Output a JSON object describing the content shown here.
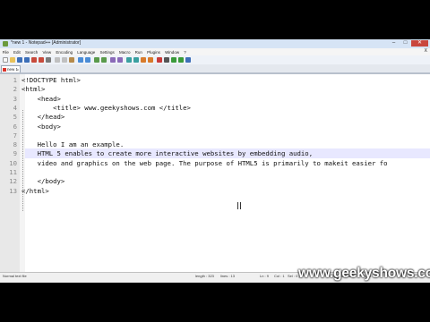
{
  "window": {
    "title": "*new 1 - Notepad++ [Administrator]",
    "minimize_glyph": "–",
    "maximize_glyph": "□",
    "close_glyph": "✕"
  },
  "menu": [
    "File",
    "Edit",
    "Search",
    "View",
    "Encoding",
    "Language",
    "Settings",
    "Macro",
    "Run",
    "Plugins",
    "Window",
    "?"
  ],
  "menu_close_glyph": "X",
  "tab": {
    "label": "new 1",
    "close_glyph": "x"
  },
  "editor": {
    "line_numbers": [
      "1",
      "2",
      "3",
      "4",
      "5",
      "6",
      "7",
      "8",
      "9",
      "10",
      "11",
      "12",
      "13"
    ],
    "lines": [
      "<!DOCTYPE html>",
      "<html>",
      "    <head>",
      "        <title> www.geekyshows.com </title>",
      "    </head>",
      "    <body>",
      "",
      "    Hello I am an example.",
      "    HTML 5 enables to create more interactive websites by embedding audio,",
      "    video and graphics on the web page. The purpose of HTML5 is primarily to makeit easier fo",
      "",
      "    </body>",
      "</html>"
    ],
    "current_line": 9
  },
  "status": {
    "file_type": "Normal text file",
    "length": "length : 323",
    "lines": "lines : 13",
    "position": "Ln : 9",
    "col": "Col : 1",
    "sel": "Sel : 0 | 0",
    "eol": "Dos\\Windows",
    "encoding": "ANSI",
    "mode": "INS"
  },
  "taskbar": {
    "apps": [
      "ie-icon",
      "explorer-icon",
      "media-icon",
      "chrome-icon",
      "firefox-icon",
      "notepadpp-icon",
      "word-icon",
      "powerpoint-icon"
    ]
  },
  "watermark": "www.geekyshows.com",
  "colors": {
    "accent": "#d6e4f5",
    "close": "#c9463d",
    "cursor_line": "#e8e8ff"
  }
}
